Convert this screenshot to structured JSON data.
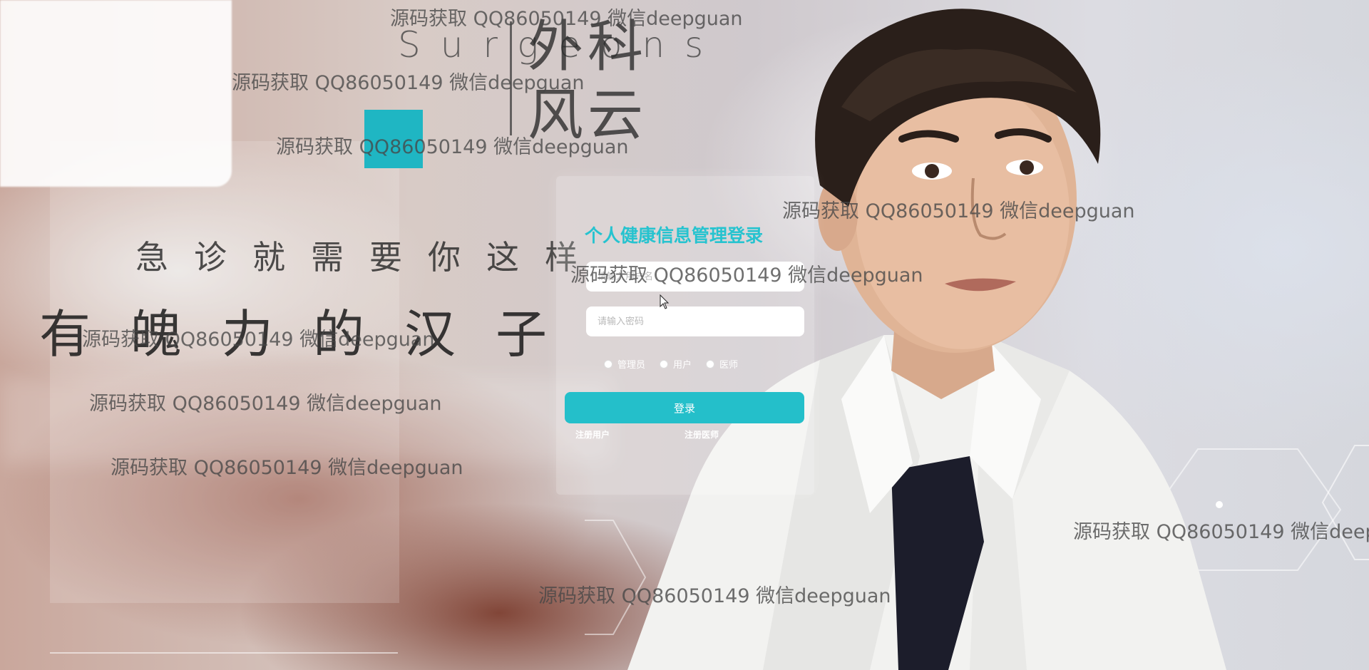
{
  "brand": {
    "letters": "Surgeons",
    "title_line1": "外科",
    "title_line2": "风云"
  },
  "slogan": {
    "line1": "急诊就需要你这样",
    "line2": "有魄力的汉子"
  },
  "login": {
    "title": "个人健康信息管理登录",
    "username_placeholder": "请输入用户名",
    "password_placeholder": "请输入密码",
    "roles": [
      {
        "label": "管理员"
      },
      {
        "label": "用户"
      },
      {
        "label": "医师"
      }
    ],
    "submit_label": "登录",
    "register_user": "注册用户",
    "register_doctor": "注册医师"
  },
  "watermark": "源码获取 QQ86050149 微信deepguan",
  "colors": {
    "accent": "#1fb6c3",
    "title": "#26c3cf",
    "button": "#24bfca"
  }
}
